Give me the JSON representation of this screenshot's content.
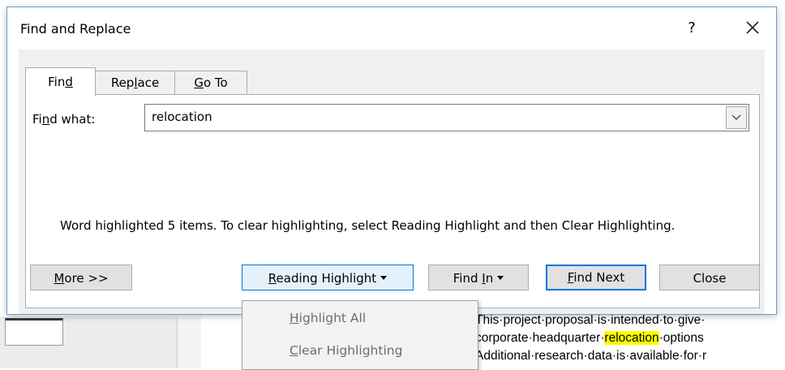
{
  "dialog": {
    "title": "Find and Replace",
    "help_label": "?",
    "tabs": [
      {
        "pre": "Fin",
        "key": "d",
        "post": ""
      },
      {
        "pre": "Rep",
        "key": "l",
        "post": "ace"
      },
      {
        "pre": "",
        "key": "G",
        "post": "o To"
      }
    ],
    "find_label": {
      "pre": "Fi",
      "key": "n",
      "post": "d what:"
    },
    "find_value": "relocation",
    "message": "Word highlighted 5 items. To clear highlighting, select Reading Highlight and then Clear Highlighting.",
    "buttons": {
      "more": {
        "pre": "",
        "key": "M",
        "post": "ore >>"
      },
      "reading_highlight": {
        "pre": "",
        "key": "R",
        "post": "eading Highlight"
      },
      "find_in": {
        "pre": "Find ",
        "key": "I",
        "post": "n"
      },
      "find_next": {
        "pre": "",
        "key": "F",
        "post": "ind Next"
      },
      "close": "Close"
    }
  },
  "menu": {
    "highlight_all": {
      "pre": "",
      "key": "H",
      "post": "ighlight All"
    },
    "clear_highlighting": {
      "pre": "",
      "key": "C",
      "post": "lear Highlighting"
    }
  },
  "document": {
    "line1": "This·project·proposal·is·intended·to·give·",
    "line2_pre": "corporate·headquarter·",
    "line2_hl": "relocation",
    "line2_post": "·options",
    "line3": "Additional·research·data·is·available·for·r"
  },
  "colors": {
    "accent": "#0078d7",
    "highlight": "#ffff00",
    "dialog_border": "#6f9ad1"
  }
}
